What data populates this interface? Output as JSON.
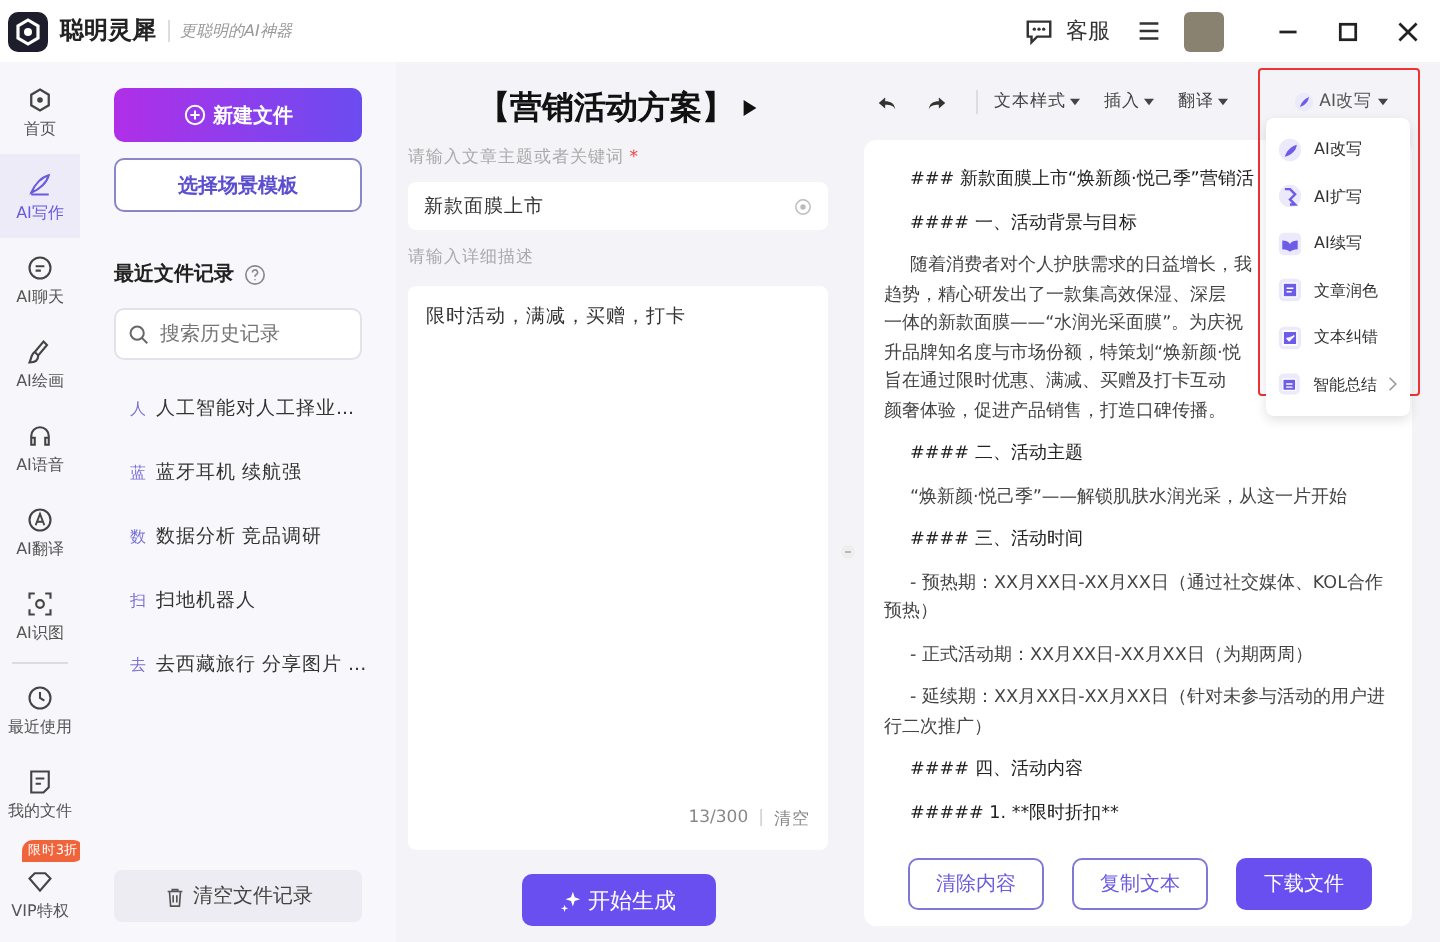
{
  "app": {
    "name": "聪明灵犀",
    "slogan": "更聪明的AI神器"
  },
  "titlebar": {
    "service": "客服"
  },
  "nav": [
    {
      "label": "首页",
      "selected": false
    },
    {
      "label": "AI写作",
      "selected": true
    },
    {
      "label": "AI聊天",
      "selected": false
    },
    {
      "label": "AI绘画",
      "selected": false
    },
    {
      "label": "AI语音",
      "selected": false
    },
    {
      "label": "AI翻译",
      "selected": false
    },
    {
      "label": "AI识图",
      "selected": false
    }
  ],
  "nav_bottom": [
    {
      "label": "最近使用"
    },
    {
      "label": "我的文件"
    },
    {
      "label": "VIP特权",
      "badge": "限时3折"
    }
  ],
  "files": {
    "new_button": "新建文件",
    "template_button": "选择场景模板",
    "recent_title": "最近文件记录",
    "search_placeholder": "搜索历史记录",
    "items": [
      {
        "mark": "人",
        "name": "人工智能对人工择业..."
      },
      {
        "mark": "蓝",
        "name": "蓝牙耳机 续航强"
      },
      {
        "mark": "数",
        "name": "数据分析 竞品调研"
      },
      {
        "mark": "扫",
        "name": "扫地机器人"
      },
      {
        "mark": "去",
        "name": "去西藏旅行 分享图片 ..."
      }
    ],
    "clear_button": "清空文件记录"
  },
  "form": {
    "title": "【营销活动方案】",
    "topic_label": "请输入文章主题或者关键词",
    "required_mark": "*",
    "topic_value": "新款面膜上市",
    "detail_label": "请输入详细描述",
    "detail_value": "限时活动，满减，买赠，打卡",
    "count": "13/300",
    "count_separator": "|",
    "clear": "清空",
    "generate_button": "开始生成"
  },
  "toolbar": {
    "items": [
      "文本样式",
      "插入",
      "翻译"
    ],
    "ai_button": "AI改写"
  },
  "ai_menu": [
    {
      "label": "AI改写"
    },
    {
      "label": "AI扩写"
    },
    {
      "label": "AI续写"
    },
    {
      "label": "文章润色"
    },
    {
      "label": "文本纠错"
    },
    {
      "label": "智能总结",
      "submenu": true
    }
  ],
  "document": {
    "blocks": [
      {
        "kind": "heading",
        "lines": [
          "### 新款面膜上市“焕新颜·悦己季”营销活"
        ]
      },
      {
        "kind": "heading",
        "lines": [
          "#### 一、活动背景与目标"
        ]
      },
      {
        "kind": "para",
        "lines": [
          "随着消费者对个人护肤需求的日益增长，我",
          "趋势，精心研发出了一款集高效保湿、深层",
          "一体的新款面膜——“水润光采面膜”。为庆祝",
          "升品牌知名度与市场份额，特策划“焕新颜·悦",
          "旨在通过限时优惠、满减、买赠及打卡互动",
          "颜奢体验，促进产品销售，打造口碑传播。"
        ]
      },
      {
        "kind": "heading",
        "lines": [
          "#### 二、活动主题"
        ]
      },
      {
        "kind": "para",
        "lines": [
          "“焕新颜·悦己季”——解锁肌肤水润光采，从这一片开始"
        ]
      },
      {
        "kind": "heading",
        "lines": [
          "#### 三、活动时间"
        ]
      },
      {
        "kind": "para",
        "lines": [
          "- 预热期：XX月XX日-XX月XX日（通过社交媒体、KOL合作",
          "预热）"
        ]
      },
      {
        "kind": "para",
        "lines": [
          "- 正式活动期：XX月XX日-XX月XX日（为期两周）"
        ]
      },
      {
        "kind": "para",
        "lines": [
          "- 延续期：XX月XX日-XX月XX日（针对未参与活动的用户进",
          "行二次推广）"
        ]
      },
      {
        "kind": "heading",
        "lines": [
          "#### 四、活动内容"
        ]
      },
      {
        "kind": "heading",
        "lines": [
          "##### 1. **限时折扣**"
        ]
      }
    ],
    "buttons": [
      {
        "label": "清除内容",
        "kind": "outline"
      },
      {
        "label": "复制文本",
        "kind": "outline"
      },
      {
        "label": "下载文件",
        "kind": "primary"
      }
    ]
  }
}
